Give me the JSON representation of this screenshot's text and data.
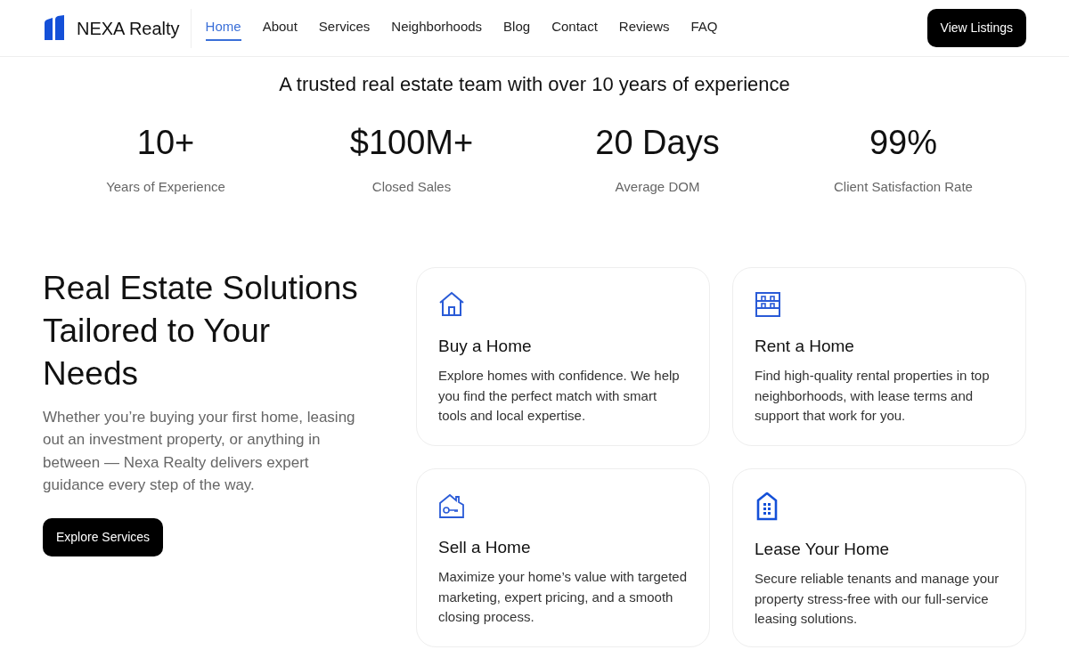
{
  "brand": {
    "name": "NEXA Realty"
  },
  "nav": [
    {
      "label": "Home",
      "selected": true
    },
    {
      "label": "About",
      "selected": false
    },
    {
      "label": "Services",
      "selected": false
    },
    {
      "label": "Neighborhoods",
      "selected": false
    },
    {
      "label": "Blog",
      "selected": false
    },
    {
      "label": "Contact",
      "selected": false
    },
    {
      "label": "Reviews",
      "selected": false
    },
    {
      "label": "FAQ",
      "selected": false
    }
  ],
  "cta": "View Listings",
  "stats_heading": "A trusted real estate team with over 10 years of experience",
  "stats": [
    {
      "value": "10+",
      "label": "Years of Experience"
    },
    {
      "value": "$100M+",
      "label": "Closed Sales"
    },
    {
      "value": "20 Days",
      "label": "Average DOM"
    },
    {
      "value": "99%",
      "label": "Client Satisfaction Rate"
    }
  ],
  "intro": {
    "heading": "Real Estate Solutions Tailored to Your Needs",
    "text": "Whether you’re buying your first home, leasing out an investment property, or anything in between — Nexa Realty delivers expert guidance every step of the way.",
    "button": "Explore Services"
  },
  "services": [
    {
      "kind": "house",
      "title": "Buy a Home",
      "text": "Explore homes with confidence. We help you find the perfect match with smart tools and local expertise."
    },
    {
      "kind": "building",
      "title": "Rent a Home",
      "text": "Find high-quality rental properties in top neighborhoods, with lease terms and support that work for you."
    },
    {
      "kind": "key",
      "title": "Sell a Home",
      "text": "Maximize your home’s value with targeted marketing, expert pricing, and a smooth closing process."
    },
    {
      "kind": "tower",
      "title": "Lease Your Home",
      "text": "Secure reliable tenants and manage your property stress-free with our full-service leasing solutions."
    }
  ]
}
